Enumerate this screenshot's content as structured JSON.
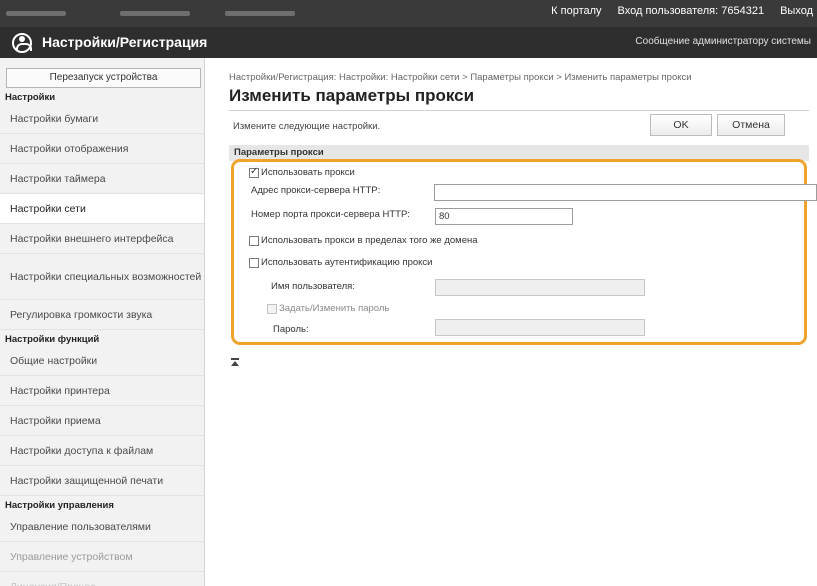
{
  "topbar": {
    "portal_link": "К порталу",
    "login_label": "Вход пользователя:",
    "login_user": "7654321",
    "logout_link": "Выход"
  },
  "header": {
    "title": "Настройки/Регистрация",
    "admin_message_link": "Сообщение администратору системы"
  },
  "sidebar": {
    "restart_button": "Перезапуск устройства",
    "sections": [
      {
        "title": "Настройки",
        "items": [
          {
            "label": "Настройки бумаги"
          },
          {
            "label": "Настройки отображения"
          },
          {
            "label": "Настройки таймера"
          },
          {
            "label": "Настройки сети"
          },
          {
            "label": "Настройки внешнего интерфейса"
          },
          {
            "label": "Настройки специальных возможностей"
          },
          {
            "label": "Регулировка громкости звука"
          }
        ]
      },
      {
        "title": "Настройки функций",
        "items": [
          {
            "label": "Общие настройки"
          },
          {
            "label": "Настройки принтера"
          },
          {
            "label": "Настройки приема"
          },
          {
            "label": "Настройки доступа к файлам"
          },
          {
            "label": "Настройки защищенной печати"
          }
        ]
      },
      {
        "title": "Настройки управления",
        "items": [
          {
            "label": "Управление пользователями"
          },
          {
            "label": "Управление устройством"
          },
          {
            "label": "Лицензия/Прочее"
          }
        ]
      }
    ],
    "active_item": "Настройки сети"
  },
  "main": {
    "breadcrumb": "Настройки/Регистрация: Настройки: Настройки сети > Параметры прокси > Изменить параметры прокси",
    "title": "Изменить параметры прокси",
    "instruction": "Измените следующие настройки.",
    "ok_button": "OK",
    "cancel_button": "Отмена",
    "section_title": "Параметры прокси",
    "form": {
      "use_proxy": {
        "label": "Использовать прокси",
        "checked": true
      },
      "server_address": {
        "label": "Адрес прокси-сервера HTTP:",
        "value": ""
      },
      "server_port": {
        "label": "Номер порта прокси-сервера HTTP:",
        "value": "80"
      },
      "same_domain": {
        "label": "Использовать прокси в пределах того же домена",
        "checked": false
      },
      "use_auth": {
        "label": "Использовать аутентификацию прокси",
        "checked": false
      },
      "username": {
        "label": "Имя пользователя:",
        "value": ""
      },
      "set_password": {
        "label": "Задать/Изменить пароль",
        "checked": false
      },
      "password": {
        "label": "Пароль:",
        "value": ""
      }
    }
  },
  "colors": {
    "highlight_frame": "#f0a32a",
    "header_bg": "#2e2e2e"
  }
}
